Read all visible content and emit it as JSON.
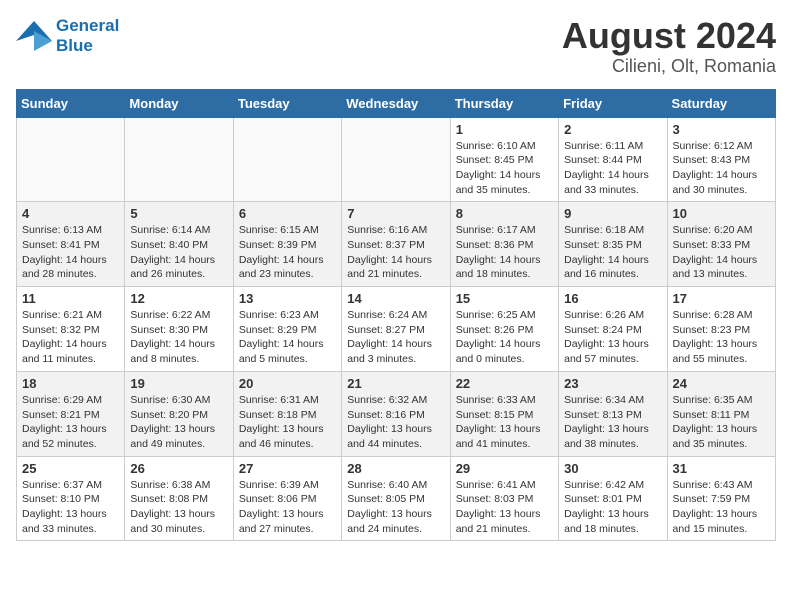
{
  "header": {
    "logo_line1": "General",
    "logo_line2": "Blue",
    "month": "August 2024",
    "location": "Cilieni, Olt, Romania"
  },
  "weekdays": [
    "Sunday",
    "Monday",
    "Tuesday",
    "Wednesday",
    "Thursday",
    "Friday",
    "Saturday"
  ],
  "weeks": [
    [
      {
        "day": "",
        "empty": true
      },
      {
        "day": "",
        "empty": true
      },
      {
        "day": "",
        "empty": true
      },
      {
        "day": "",
        "empty": true
      },
      {
        "day": "1",
        "sunrise": "6:10 AM",
        "sunset": "8:45 PM",
        "daylight": "14 hours and 35 minutes."
      },
      {
        "day": "2",
        "sunrise": "6:11 AM",
        "sunset": "8:44 PM",
        "daylight": "14 hours and 33 minutes."
      },
      {
        "day": "3",
        "sunrise": "6:12 AM",
        "sunset": "8:43 PM",
        "daylight": "14 hours and 30 minutes."
      }
    ],
    [
      {
        "day": "4",
        "sunrise": "6:13 AM",
        "sunset": "8:41 PM",
        "daylight": "14 hours and 28 minutes."
      },
      {
        "day": "5",
        "sunrise": "6:14 AM",
        "sunset": "8:40 PM",
        "daylight": "14 hours and 26 minutes."
      },
      {
        "day": "6",
        "sunrise": "6:15 AM",
        "sunset": "8:39 PM",
        "daylight": "14 hours and 23 minutes."
      },
      {
        "day": "7",
        "sunrise": "6:16 AM",
        "sunset": "8:37 PM",
        "daylight": "14 hours and 21 minutes."
      },
      {
        "day": "8",
        "sunrise": "6:17 AM",
        "sunset": "8:36 PM",
        "daylight": "14 hours and 18 minutes."
      },
      {
        "day": "9",
        "sunrise": "6:18 AM",
        "sunset": "8:35 PM",
        "daylight": "14 hours and 16 minutes."
      },
      {
        "day": "10",
        "sunrise": "6:20 AM",
        "sunset": "8:33 PM",
        "daylight": "14 hours and 13 minutes."
      }
    ],
    [
      {
        "day": "11",
        "sunrise": "6:21 AM",
        "sunset": "8:32 PM",
        "daylight": "14 hours and 11 minutes."
      },
      {
        "day": "12",
        "sunrise": "6:22 AM",
        "sunset": "8:30 PM",
        "daylight": "14 hours and 8 minutes."
      },
      {
        "day": "13",
        "sunrise": "6:23 AM",
        "sunset": "8:29 PM",
        "daylight": "14 hours and 5 minutes."
      },
      {
        "day": "14",
        "sunrise": "6:24 AM",
        "sunset": "8:27 PM",
        "daylight": "14 hours and 3 minutes."
      },
      {
        "day": "15",
        "sunrise": "6:25 AM",
        "sunset": "8:26 PM",
        "daylight": "14 hours and 0 minutes."
      },
      {
        "day": "16",
        "sunrise": "6:26 AM",
        "sunset": "8:24 PM",
        "daylight": "13 hours and 57 minutes."
      },
      {
        "day": "17",
        "sunrise": "6:28 AM",
        "sunset": "8:23 PM",
        "daylight": "13 hours and 55 minutes."
      }
    ],
    [
      {
        "day": "18",
        "sunrise": "6:29 AM",
        "sunset": "8:21 PM",
        "daylight": "13 hours and 52 minutes."
      },
      {
        "day": "19",
        "sunrise": "6:30 AM",
        "sunset": "8:20 PM",
        "daylight": "13 hours and 49 minutes."
      },
      {
        "day": "20",
        "sunrise": "6:31 AM",
        "sunset": "8:18 PM",
        "daylight": "13 hours and 46 minutes."
      },
      {
        "day": "21",
        "sunrise": "6:32 AM",
        "sunset": "8:16 PM",
        "daylight": "13 hours and 44 minutes."
      },
      {
        "day": "22",
        "sunrise": "6:33 AM",
        "sunset": "8:15 PM",
        "daylight": "13 hours and 41 minutes."
      },
      {
        "day": "23",
        "sunrise": "6:34 AM",
        "sunset": "8:13 PM",
        "daylight": "13 hours and 38 minutes."
      },
      {
        "day": "24",
        "sunrise": "6:35 AM",
        "sunset": "8:11 PM",
        "daylight": "13 hours and 35 minutes."
      }
    ],
    [
      {
        "day": "25",
        "sunrise": "6:37 AM",
        "sunset": "8:10 PM",
        "daylight": "13 hours and 33 minutes."
      },
      {
        "day": "26",
        "sunrise": "6:38 AM",
        "sunset": "8:08 PM",
        "daylight": "13 hours and 30 minutes."
      },
      {
        "day": "27",
        "sunrise": "6:39 AM",
        "sunset": "8:06 PM",
        "daylight": "13 hours and 27 minutes."
      },
      {
        "day": "28",
        "sunrise": "6:40 AM",
        "sunset": "8:05 PM",
        "daylight": "13 hours and 24 minutes."
      },
      {
        "day": "29",
        "sunrise": "6:41 AM",
        "sunset": "8:03 PM",
        "daylight": "13 hours and 21 minutes."
      },
      {
        "day": "30",
        "sunrise": "6:42 AM",
        "sunset": "8:01 PM",
        "daylight": "13 hours and 18 minutes."
      },
      {
        "day": "31",
        "sunrise": "6:43 AM",
        "sunset": "7:59 PM",
        "daylight": "13 hours and 15 minutes."
      }
    ]
  ]
}
